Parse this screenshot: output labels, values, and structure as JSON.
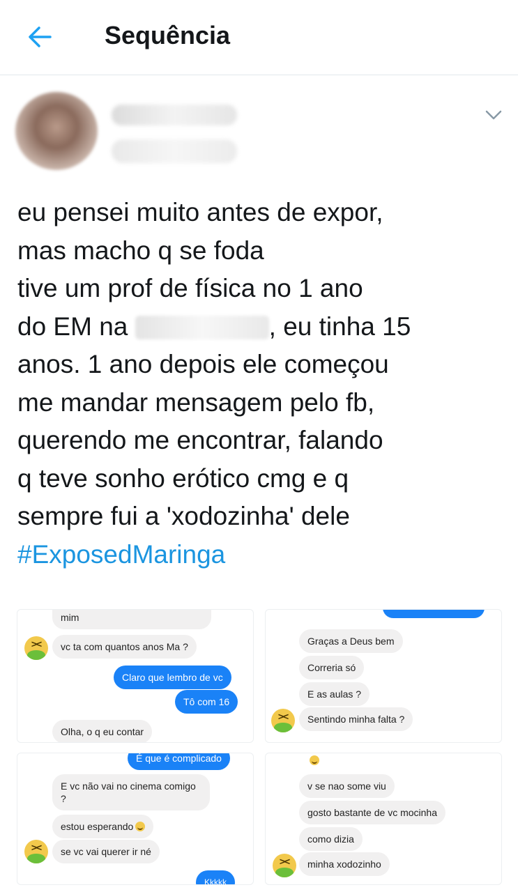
{
  "header": {
    "title": "Sequência",
    "back_icon": "arrow-left-icon",
    "accent": "#1da1f2"
  },
  "tweet": {
    "more_icon": "chevron-down-icon",
    "lines": [
      "eu pensei muito antes de expor,",
      "mas macho q se foda",
      "tive um prof de física no 1 ano",
      "do EM na",
      ", eu tinha 15",
      "anos. 1 ano depois ele começou",
      "me mandar mensagem pelo fb,",
      "querendo me encontrar, falando",
      "q teve sonho erótico cmg e q",
      "sempre fui a 'xodozinha' dele"
    ],
    "hashtag": "#ExposedMaringa",
    "hashtag_color": "#1b95e0"
  },
  "screenshots": {
    "panel1": {
      "m1": "mim",
      "m2": "vc ta com quantos anos Ma ?",
      "m3": "Claro que lembro de vc",
      "m4": "Tô com 16",
      "m5": "Olha, o q eu contar"
    },
    "panel2": {
      "m1": "Graças a Deus bem",
      "m2": "Correria só",
      "m3": "E as aulas ?",
      "m4": "Sentindo minha falta ?"
    },
    "panel3": {
      "m0": "É que é complicado",
      "m1": "E vc não vai no cinema comigo ?",
      "m2": "estou esperando",
      "m3": "se vc vai querer ir né",
      "m4": "Kkkkk"
    },
    "panel4": {
      "m1": "v se nao some viu",
      "m2": "gosto bastante de vc mocinha",
      "m3": "como dizia",
      "m4": "minha xodozinho"
    },
    "out_bubble_color": "#1a82f7",
    "in_bubble_color": "#f1f0f0",
    "avatar_icon": "vomiting-face-icon"
  }
}
